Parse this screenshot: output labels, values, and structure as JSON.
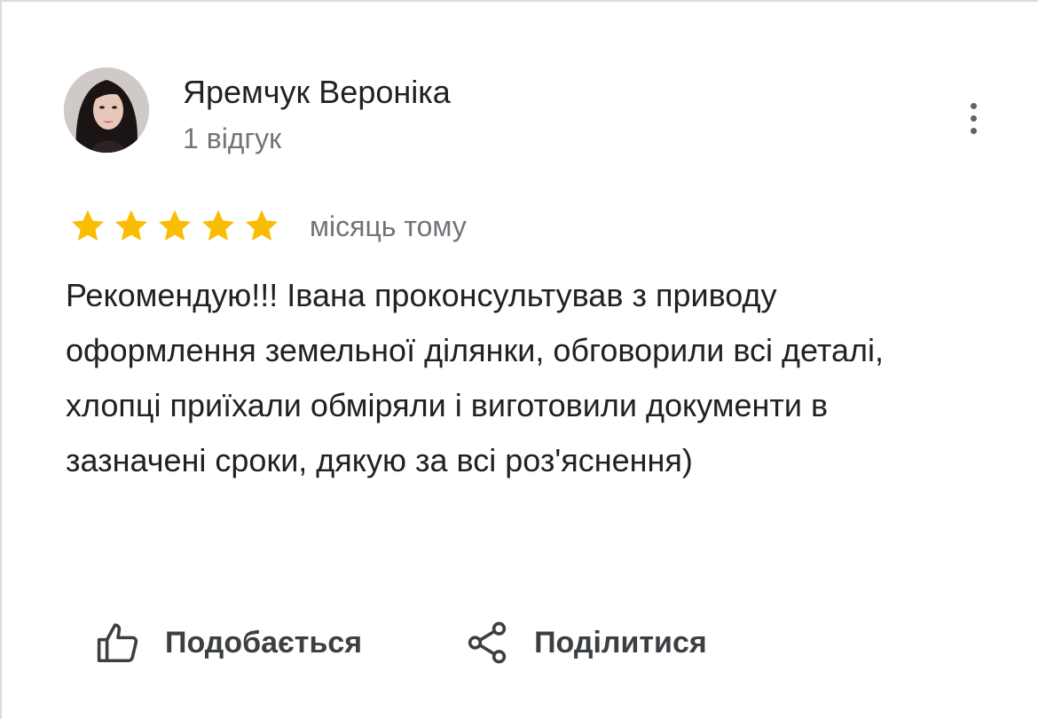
{
  "review": {
    "author_name": "Яремчук Вероніка",
    "review_count": "1 відгук",
    "rating": 5,
    "rating_max": 5,
    "star_color": "#fbbc04",
    "time_ago": "місяць тому",
    "text": "Рекомендую!!! Івана проконсультував з приводу оформлення земельної ділянки, обговорили всі деталі, хлопці приїхали обміряли і виготовили документи в зазначені сроки, дякую за всі роз'яснення)"
  },
  "actions": {
    "like_label": "Подобається",
    "like_icon": "thumb-up-icon",
    "share_label": "Поділитися",
    "share_icon": "share-icon"
  },
  "menu": {
    "icon": "more-vert-icon"
  },
  "avatar": {
    "icon": "avatar"
  }
}
